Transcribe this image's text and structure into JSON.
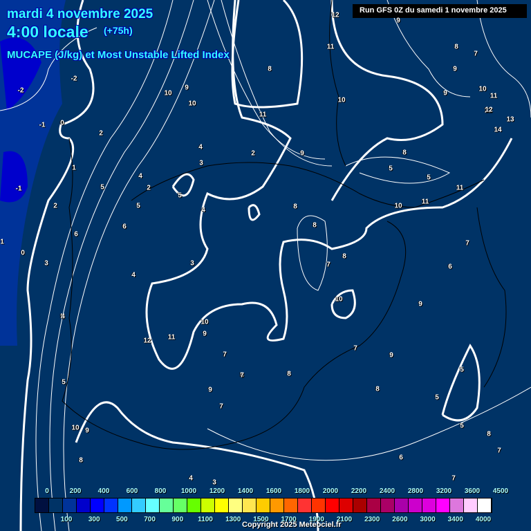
{
  "header": {
    "date": "mardi 4 novembre 2025",
    "time": "4:00 locale",
    "lead": "(+75h)",
    "subtitle": "MUCAPE (J/kg) et Most Unstable Lifted Index",
    "run": "Run GFS 0Z du samedi 1 novembre 2025"
  },
  "lifted_index_labels": [
    "-2",
    "-2",
    "-1",
    "0",
    "-1",
    "1",
    "0",
    "2",
    "1",
    "2",
    "3",
    "6",
    "5",
    "5",
    "6",
    "12",
    "4",
    "5",
    "4",
    "2",
    "2",
    "4",
    "3",
    "3",
    "5",
    "4",
    "10",
    "10",
    "9",
    "8",
    "11",
    "12",
    "11",
    "10",
    "8",
    "9",
    "9",
    "5",
    "5",
    "11",
    "10",
    "11",
    "12",
    "8",
    "7",
    "9",
    "10",
    "11",
    "12",
    "13",
    "14",
    "9",
    "8",
    "6",
    "6",
    "8",
    "7",
    "8",
    "7",
    "10",
    "9",
    "9",
    "10",
    "11",
    "9",
    "7",
    "7",
    "8",
    "8",
    "8",
    "9",
    "7",
    "5",
    "5",
    "5",
    "8",
    "7",
    "6",
    "7",
    "5",
    "4",
    "3",
    "4",
    "9",
    "10",
    "8",
    "7"
  ],
  "colorbar": {
    "colors": [
      "#001040",
      "#003366",
      "#003399",
      "#0000cc",
      "#0000ff",
      "#0033ff",
      "#0099ff",
      "#33ccff",
      "#66ffff",
      "#66ff99",
      "#66ff66",
      "#66ff00",
      "#ccff00",
      "#ffff00",
      "#ffff80",
      "#ffe650",
      "#ffcc00",
      "#ff9900",
      "#ff6600",
      "#ff3333",
      "#ff3300",
      "#ff0000",
      "#dd0000",
      "#aa0000",
      "#aa0044",
      "#aa0066",
      "#aa00aa",
      "#cc00cc",
      "#dd00dd",
      "#ff00ff",
      "#dd77dd",
      "#ffccff",
      "#ffffff"
    ],
    "top_ticks": [
      "0",
      "200",
      "400",
      "600",
      "800",
      "1000",
      "1200",
      "1400",
      "1600",
      "1800",
      "2000",
      "2200",
      "2400",
      "2800",
      "3200",
      "3600",
      "4500"
    ],
    "bottom_ticks": [
      "100",
      "300",
      "500",
      "700",
      "900",
      "1100",
      "1300",
      "1500",
      "1700",
      "1900",
      "2100",
      "2300",
      "2600",
      "3000",
      "3400",
      "4000"
    ]
  },
  "copyright": "Copyright 2025 Meteociel.fr"
}
